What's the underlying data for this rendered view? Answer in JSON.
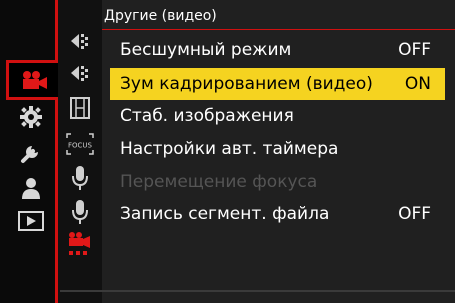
{
  "header": {
    "title": "Другие (видео)"
  },
  "menu": {
    "items": [
      {
        "label": "Бесшумный режим",
        "value": "OFF",
        "state": "normal"
      },
      {
        "label": "Зум кадрированием (видео)",
        "value": "ON",
        "state": "selected"
      },
      {
        "label": "Стаб. изображения",
        "value": "",
        "state": "normal"
      },
      {
        "label": "Настройки авт. таймера",
        "value": "",
        "state": "normal"
      },
      {
        "label": "Перемещение фокуса",
        "value": "",
        "state": "disabled"
      },
      {
        "label": "Запись сегмент. файла",
        "value": "OFF",
        "state": "normal"
      }
    ]
  },
  "main_categories": [
    "video-camera-icon",
    "gear-icon",
    "wrench-icon",
    "person-icon",
    "playback-icon"
  ],
  "sub_tabs": [
    "exposure-icon-1",
    "exposure-icon-2",
    "film-icon",
    "focus-icon",
    "mic-icon-1",
    "mic-icon-2",
    "video-camera-dots-icon"
  ],
  "sub_tabs_text": {
    "focus": "FOCUS"
  },
  "colors": {
    "accent": "#d01010",
    "highlight": "#f5d320",
    "background": "#202020"
  }
}
